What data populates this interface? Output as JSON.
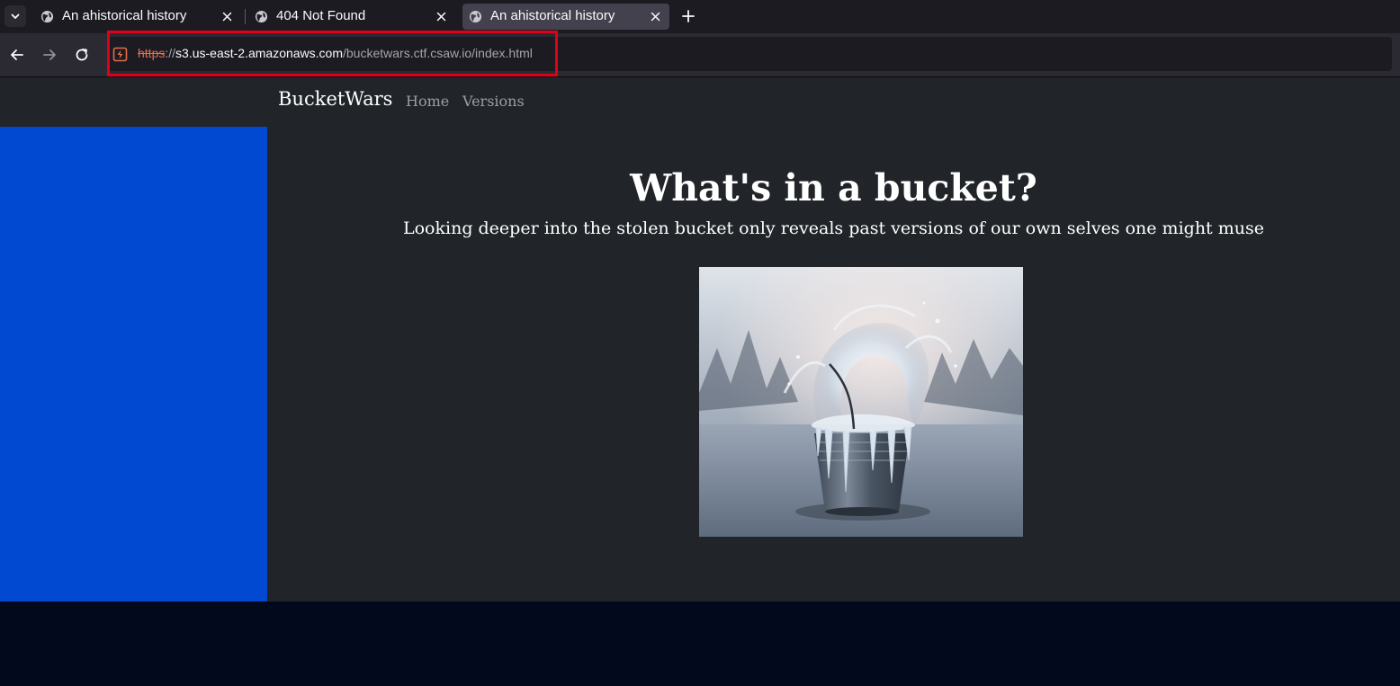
{
  "browser": {
    "tabs": [
      {
        "title": "An ahistorical history",
        "active": false
      },
      {
        "title": "404 Not Found",
        "active": false
      },
      {
        "title": "An ahistorical history",
        "active": true
      }
    ],
    "url": {
      "scheme": "https",
      "separator": "://",
      "host": "s3.us-east-2.amazonaws.com",
      "path": "/bucketwars.ctf.csaw.io/index.html",
      "security_icon": "insecure-connection-icon"
    },
    "icons": {
      "tab_list": "chevron-down-icon",
      "tab_favicon": "globe-icon",
      "tab_close": "close-icon",
      "new_tab": "plus-icon",
      "back": "back-arrow-icon",
      "forward": "forward-arrow-icon",
      "reload": "reload-icon"
    },
    "highlight_color": "#e0001a"
  },
  "site": {
    "brand": "BucketWars",
    "nav": [
      {
        "label": "Home"
      },
      {
        "label": "Versions"
      }
    ],
    "hero": {
      "title": "What's in a bucket?",
      "subtitle": "Looking deeper into the stolen bucket only reveals past versions of our own selves one might muse",
      "image": "frozen-bucket-splash-image"
    },
    "colors": {
      "background": "#212529",
      "sidebar": "#0049d0",
      "footer": "#02091d"
    }
  }
}
